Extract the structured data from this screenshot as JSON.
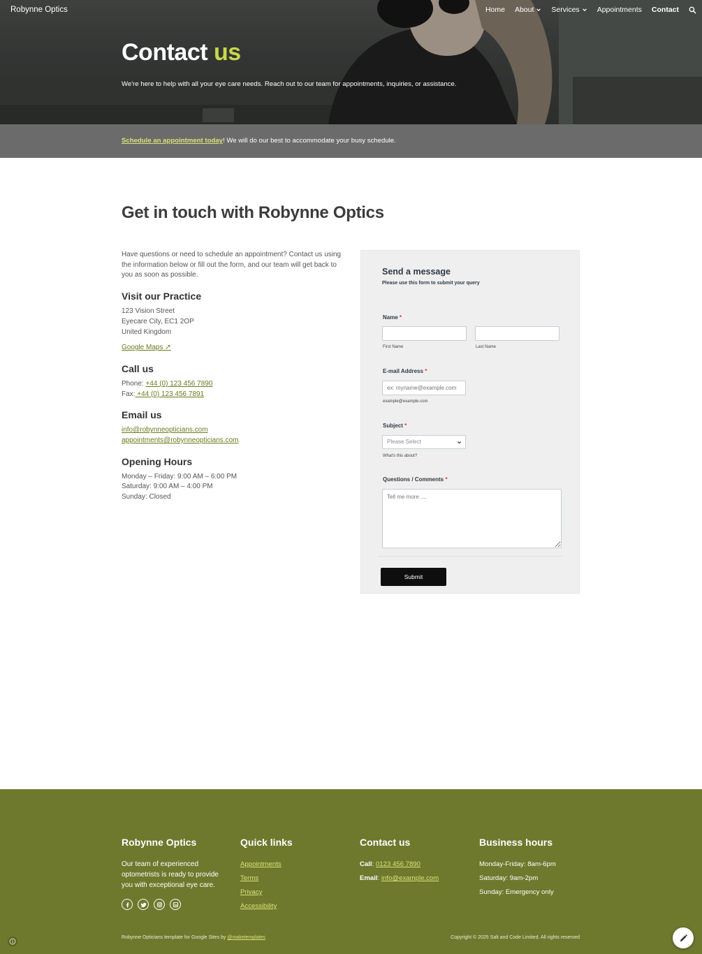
{
  "header": {
    "brand": "Robynne Optics",
    "nav": [
      {
        "label": "Home"
      },
      {
        "label": "About"
      },
      {
        "label": "Services"
      },
      {
        "label": "Appointments"
      },
      {
        "label": "Contact"
      }
    ],
    "search_icon": "search-icon"
  },
  "hero": {
    "title_main": "Contact",
    "title_accent": "us",
    "subtitle": "We're here to help with all your eye care needs. Reach out to our team for appointments, inquiries, or assistance."
  },
  "banner": {
    "link": "Schedule an appointment today",
    "rest": "! We will do our best to accommodate your busy schedule."
  },
  "main": {
    "heading": "Get in touch with Robynne Optics",
    "intro": "Have questions or need to schedule an appointment? Contact us using the information below or fill out the form, and our team will get back to you as soon as possible.",
    "visit_heading": "Visit our Practice",
    "address": [
      "123 Vision Street",
      "Eyecare City, EC1 2OP",
      "United Kingdom"
    ],
    "maps_link": "Google Maps ↗",
    "call_heading": "Call us",
    "phone_label": "Phone: ",
    "phone": "+44 (0) 123 456 7890",
    "fax_label": "Fax:",
    "fax": " +44 (0) 123 456 7891",
    "email_heading": "Email us",
    "emails": [
      "info@robynneopticians.com",
      "appointments@robynneopticians.com"
    ],
    "hours_heading": "Opening Hours",
    "hours": [
      "Monday – Friday: 9:00 AM – 6:00 PM",
      "Saturday: 9:00 AM – 4:00 PM",
      "Sunday: Closed"
    ]
  },
  "form": {
    "title": "Send a message",
    "description": "Please use this form to submit your query",
    "name_label": "Name",
    "first_name_hint": "First Name",
    "last_name_hint": "Last Name",
    "email_label": "E-mail Address",
    "email_placeholder": "ex: myname@example.com",
    "email_hint": "example@example.com",
    "subject_label": "Subject",
    "subject_value": "Please Select",
    "subject_hint": "What's this about?",
    "comments_label": "Questions / Comments",
    "comments_placeholder": "Tell me more ....",
    "required_mark": "*",
    "submit": "Submit"
  },
  "footer": {
    "about_heading": "Robynne Optics",
    "about_text": "Our team of experienced optometrists is ready to provide you with exceptional eye care.",
    "quick_heading": "Quick links",
    "quick_links": [
      "Appointments",
      "Terms",
      "Privacy",
      "Accessibility"
    ],
    "contact_heading": "Contact us",
    "call_label": "Call",
    "call_value": "0123 456 7890",
    "email_label": "Email",
    "email_value": "info@example.com",
    "hours_heading": "Business hours",
    "hours": [
      "Monday-Friday: 8am-6pm",
      "Saturday: 9am-2pm",
      "Sunday: Emergency only"
    ],
    "credit_text": "Robynne Opticians template for Google Sites by ",
    "credit_link": "@maketemplates",
    "copyright": "Copyright © 2025 Salt and Code Limited. All rights reserved"
  },
  "colors": {
    "accent": "#c7d84a",
    "footer_bg": "#6e792d",
    "banner_bg": "#6b6b6b",
    "link_green": "#6b7a1f",
    "submit_bg": "#0e0e0e"
  }
}
